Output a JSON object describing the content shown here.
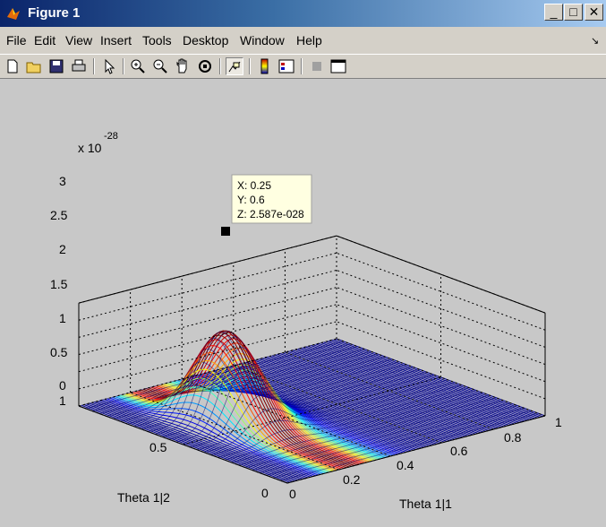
{
  "window": {
    "title": "Figure 1",
    "minimize": "_",
    "maximize": "□",
    "close": "✕"
  },
  "menu": {
    "items": [
      "File",
      "Edit",
      "View",
      "Insert",
      "Tools",
      "Desktop",
      "Window",
      "Help"
    ],
    "corner_arrow": "↘"
  },
  "toolbar": {
    "icons": [
      "new-file-icon",
      "open-folder-icon",
      "save-icon",
      "print-icon",
      "pointer-icon",
      "zoom-in-icon",
      "zoom-out-icon",
      "pan-hand-icon",
      "rotate-3d-icon",
      "data-cursor-icon",
      "colorbar-icon",
      "legend-icon",
      "hide-plot-tools-icon",
      "show-plot-tools-icon"
    ]
  },
  "chart_data": {
    "type": "surface",
    "z_exponent_label": "x 10",
    "z_exponent": "-28",
    "xlabel": "Theta 1|1",
    "ylabel": "Theta 1|2",
    "x_ticks": [
      "0",
      "0.2",
      "0.4",
      "0.6",
      "0.8",
      "1"
    ],
    "y_ticks": [
      "0",
      "0.5",
      "1"
    ],
    "z_ticks": [
      "0",
      "0.5",
      "1",
      "1.5",
      "2",
      "2.5",
      "3"
    ],
    "xlim": [
      0,
      1
    ],
    "ylim": [
      0,
      1
    ],
    "zlim": [
      0,
      3
    ],
    "peak": {
      "x": 0.25,
      "y": 0.6,
      "z": 2.587
    },
    "grid": true,
    "colormap": "jet",
    "datatip": {
      "x_line": "X: 0.25",
      "y_line": "Y: 0.6",
      "z_line": "Z: 2.587e-028"
    }
  }
}
